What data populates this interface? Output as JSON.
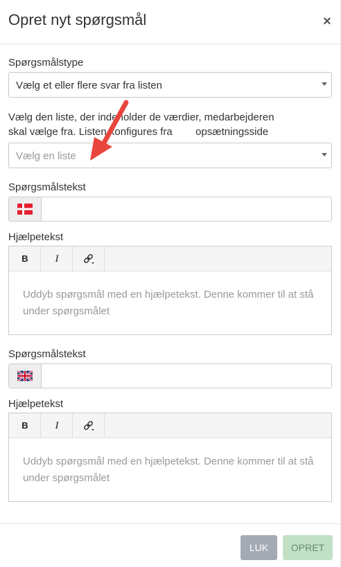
{
  "modal": {
    "title": "Opret nyt spørgsmål",
    "close_label": "×"
  },
  "question_type": {
    "label": "Spørgsmålstype",
    "value": "Vælg et eller flere svar fra listen"
  },
  "list_select": {
    "help_line1": "Vælg den liste, der indeholder de værdier, medarbejderen",
    "help_line2": "skal vælge fra. Listen konfigures fra        opsætningsside",
    "placeholder": "Vælg en liste"
  },
  "danish": {
    "question_label": "Spørgsmålstekst",
    "flag_icon": "denmark-flag-icon",
    "question_value": "",
    "help_label": "Hjælpetekst",
    "toolbar": {
      "bold": "B",
      "italic": "I",
      "link_icon": "link-icon"
    },
    "help_placeholder": "Uddyb spørgsmål med en hjælpetekst. Denne kommer til at stå under spørgsmålet"
  },
  "english": {
    "question_label": "Spørgsmålstekst",
    "flag_icon": "uk-flag-icon",
    "question_value": "",
    "help_label": "Hjælpetekst",
    "toolbar": {
      "bold": "B",
      "italic": "I",
      "link_icon": "link-icon"
    },
    "help_placeholder": "Uddyb spørgsmål med en hjælpetekst. Denne kommer til at stå under spørgsmålet"
  },
  "footer": {
    "close_button": "LUK",
    "create_button": "OPRET"
  },
  "colors": {
    "close_button_bg": "#a4aab4",
    "create_button_bg": "#c2e0c6",
    "annotation_arrow": "#e8453c"
  }
}
